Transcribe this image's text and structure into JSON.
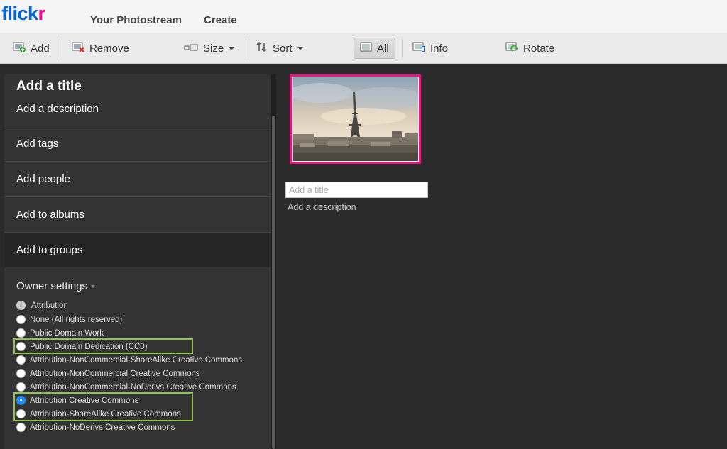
{
  "header": {
    "logo_part1": "flick",
    "logo_part2": "r",
    "nav": [
      "Your Photostream",
      "Create"
    ]
  },
  "toolbar": {
    "add_label": "Add",
    "remove_label": "Remove",
    "size_label": "Size",
    "sort_label": "Sort",
    "all_label": "All",
    "info_label": "Info",
    "rotate_label": "Rotate"
  },
  "panel": {
    "title": "Add a title",
    "description": "Add a description",
    "sections": [
      "Add tags",
      "Add people",
      "Add to albums",
      "Add to groups"
    ],
    "owner_settings": "Owner settings",
    "attribution_label": "Attribution",
    "license_options": [
      "None (All rights reserved)",
      "Public Domain Work",
      "Public Domain Dedication (CC0)",
      "Attribution-NonCommercial-ShareAlike Creative Commons",
      "Attribution-NonCommercial Creative Commons",
      "Attribution-NonCommercial-NoDerivs Creative Commons",
      "Attribution Creative Commons",
      "Attribution-ShareAlike Creative Commons",
      "Attribution-NoDerivs Creative Commons"
    ],
    "selected_license": "Attribution Creative Commons"
  },
  "photo": {
    "title_placeholder": "Add a title",
    "description_link": "Add a description"
  },
  "colors": {
    "logo_blue": "#0063dc",
    "logo_pink": "#ff0084",
    "selection_border": "#e8177f",
    "highlight_green": "#8fc54a",
    "radio_selected": "#1d8cf8"
  }
}
